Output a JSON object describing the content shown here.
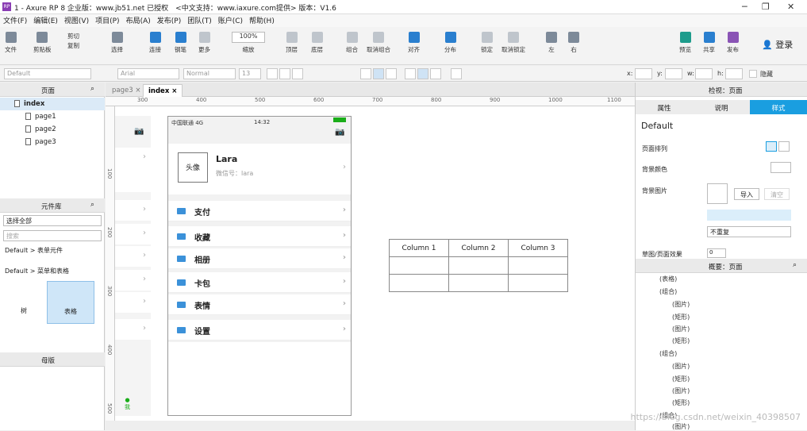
{
  "window": {
    "title": "1 - Axure RP 8 企业版：www.jb51.net 已授权　<中文支持：www.iaxure.com提供> 版本：V1.6",
    "app_badge": "RP"
  },
  "menu": [
    "文件(F)",
    "编辑(E)",
    "视图(V)",
    "项目(P)",
    "布局(A)",
    "发布(P)",
    "团队(T)",
    "账户(C)",
    "帮助(H)"
  ],
  "toolbar": {
    "file": "文件",
    "clipboard": "剪贴板",
    "cut": "剪切",
    "copy": "复制",
    "paste": "粘贴",
    "select": "选择",
    "connect": "连接",
    "pen": "钢笔",
    "more": "更多",
    "zoom_value": "100%",
    "zoom_label": "缩放",
    "top": "顶层",
    "bottom": "底层",
    "group": "组合",
    "ungroup": "取消组合",
    "align": "对齐",
    "distribute": "分布",
    "lock": "锁定",
    "unlock": "取消锁定",
    "left": "左",
    "right": "右",
    "preview": "预览",
    "share": "共享",
    "publish": "发布",
    "login": "登录"
  },
  "stylebar": {
    "style": "Default",
    "font": "Arial",
    "weight": "Normal",
    "size": "13",
    "x_label": "x:",
    "y_label": "y:",
    "w_label": "w:",
    "h_label": "h:",
    "hidden_label": "隐藏"
  },
  "pages_panel": {
    "title": "页面",
    "items": [
      {
        "label": "index"
      },
      {
        "label": "page1"
      },
      {
        "label": "page2"
      },
      {
        "label": "page3"
      }
    ]
  },
  "widgets_panel": {
    "title": "元件库",
    "library": "选择全部",
    "search_placeholder": "搜索",
    "group1": "Default > 表单元件",
    "group2": "Default > 菜单和表格",
    "item_tree": "树",
    "item_table": "表格"
  },
  "masters_panel": {
    "title": "母版"
  },
  "tabs": [
    {
      "label": "page3"
    },
    {
      "label": "index"
    }
  ],
  "ruler_marks": [
    "300",
    "400",
    "500",
    "600",
    "700",
    "800",
    "900",
    "1000",
    "1100"
  ],
  "vruler_marks": [
    "100",
    "200",
    "300",
    "400",
    "500"
  ],
  "phone": {
    "carrier": "中国联通  4G",
    "time": "14:32",
    "avatar": "头像",
    "name": "Lara",
    "wechat": "微信号：lara",
    "items": [
      "支付",
      "收藏",
      "相册",
      "卡包",
      "表情",
      "设置"
    ],
    "me": "我"
  },
  "table": {
    "headers": [
      "Column 1",
      "Column 2",
      "Column 3"
    ]
  },
  "inspector": {
    "title": "检视：页面",
    "tabs": [
      "属性",
      "说明",
      "样式"
    ],
    "style": "Default",
    "page_align": "页面排列",
    "bg_color": "背景颜色",
    "bg_image": "背景图片",
    "import": "导入",
    "clear": "清空",
    "repeat": "不重复",
    "sketch": "草图/页面效果",
    "sketch_value": "0"
  },
  "outline": {
    "title": "概要：页面",
    "items": [
      "(表格)",
      "(组合)",
      "(图片)",
      "(矩形)",
      "(图片)",
      "(矩形)",
      "(组合)",
      "(图片)",
      "(矩形)",
      "(图片)",
      "(矩形)",
      "(组合)",
      "(图片)"
    ]
  },
  "watermark": "https://blog.csdn.net/weixin_40398507"
}
